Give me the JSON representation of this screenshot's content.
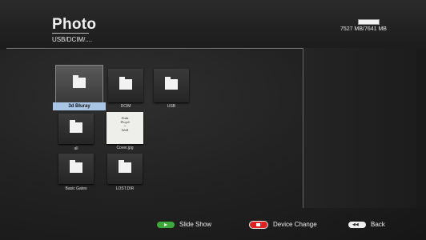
{
  "header": {
    "title": "Photo",
    "path": "USB/DCIM/....",
    "storage": {
      "text": "7527 MB/7641 MB",
      "used_fraction": 0.985
    }
  },
  "items": [
    {
      "label": "3d Bluray",
      "type": "folder",
      "selected": true,
      "icon": "folder-icon"
    },
    {
      "label": "DCIM",
      "type": "folder",
      "selected": false,
      "icon": "folder-icon"
    },
    {
      "label": "USB",
      "type": "folder",
      "selected": false,
      "icon": "folder-icon"
    },
    {
      "label": "all",
      "type": "folder",
      "selected": false,
      "icon": "folder-icon"
    },
    {
      "label": "Cover.jpg",
      "type": "photo",
      "selected": false,
      "icon": "photo-thumbnail"
    },
    {
      "label": "Basic Gates",
      "type": "folder",
      "selected": false,
      "icon": "folder-icon"
    },
    {
      "label": "LOST.DIR",
      "type": "folder",
      "selected": false,
      "icon": "folder-icon"
    }
  ],
  "footer": {
    "slide_show": {
      "label": "Slide Show",
      "color": "#3fa83a",
      "icon": "play-icon"
    },
    "device_change": {
      "label": "Device Change",
      "color": "#dd2222",
      "icon": "stop-icon"
    },
    "back": {
      "label": "Back",
      "color": "#eeeeee",
      "icon": "rewind-icon"
    }
  }
}
